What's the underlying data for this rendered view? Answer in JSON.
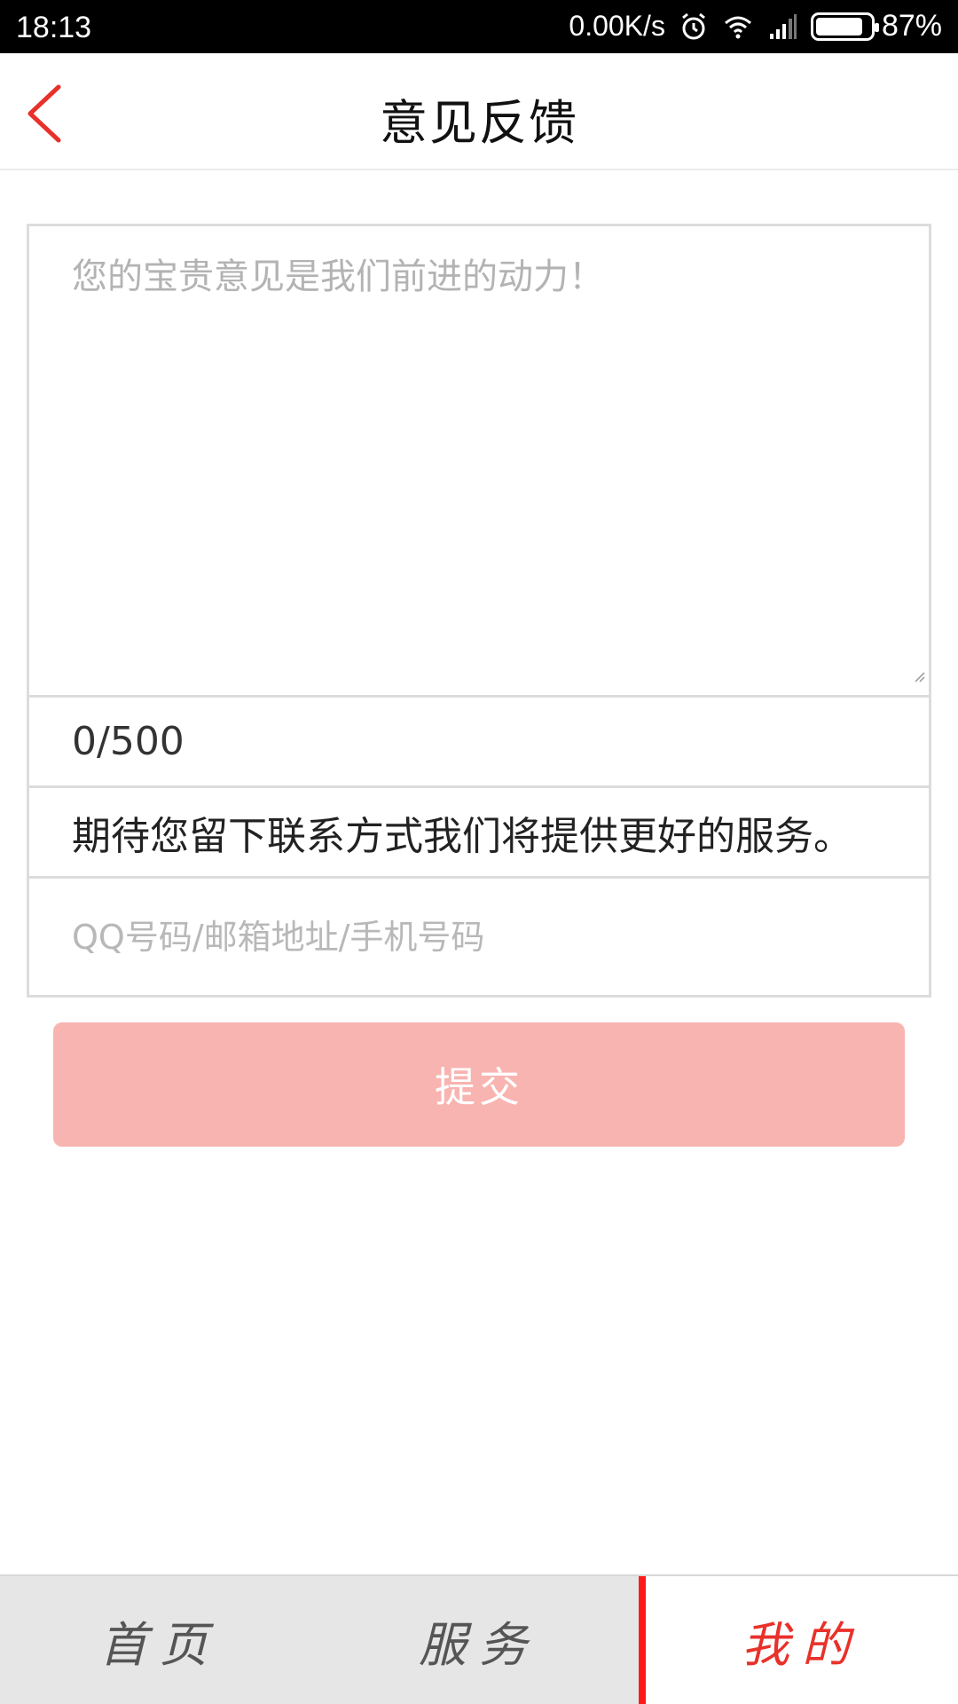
{
  "status_bar": {
    "time": "18:13",
    "network_speed": "0.00K/s",
    "battery_percent": "87%",
    "battery_level": 0.87,
    "icons": [
      "alarm-icon",
      "wifi-icon",
      "signal-icon",
      "battery-icon"
    ]
  },
  "header": {
    "title": "意见反馈",
    "back_icon": "chevron-left-icon"
  },
  "form": {
    "feedback_placeholder": "您的宝贵意见是我们前进的动力！",
    "feedback_value": "",
    "counter": "0/500",
    "contact_hint": "期待您留下联系方式我们将提供更好的服务。",
    "contact_placeholder": "QQ号码/邮箱地址/手机号码",
    "contact_value": ""
  },
  "submit": {
    "label": "提交",
    "color": "#f8b4b1"
  },
  "tab_bar": {
    "items": [
      {
        "label": "首页",
        "active": false
      },
      {
        "label": "服务",
        "active": false
      },
      {
        "label": "我的",
        "active": true
      }
    ],
    "active_color": "#e8312a",
    "inactive_color": "#555555"
  },
  "colors": {
    "accent": "#e8312a"
  }
}
